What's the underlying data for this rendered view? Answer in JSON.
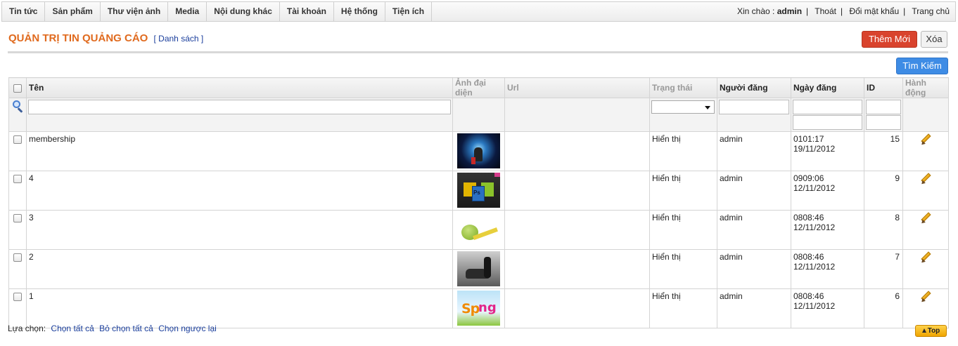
{
  "nav": {
    "menu": [
      "Tin tức",
      "Sản phẩm",
      "Thư viện ảnh",
      "Media",
      "Nội dung khác",
      "Tài khoản",
      "Hệ thống",
      "Tiện ích"
    ],
    "greeting": "Xin chào :",
    "username": "admin",
    "logout": "Thoát",
    "change_password": "Đổi mật khẩu",
    "home": "Trang chủ"
  },
  "header": {
    "title": "QUẢN TRỊ TIN QUẢNG CÁO",
    "sub_link": "[ Danh sách ]",
    "add_button": "Thêm Mới",
    "delete_button": "Xóa",
    "search_button": "Tìm Kiếm"
  },
  "table": {
    "columns": {
      "name": "Tên",
      "image": "Ảnh đại diện",
      "url": "Url",
      "status": "Trạng thái",
      "poster": "Người đăng",
      "date": "Ngày đăng",
      "id": "ID",
      "action": "Hành động"
    },
    "rows": [
      {
        "name": "membership",
        "status": "Hiển thị",
        "poster": "admin",
        "time": "0101:17",
        "date": "19/11/2012",
        "id": "15",
        "image_icon": "membership-thumbnail"
      },
      {
        "name": "4",
        "status": "Hiển thị",
        "poster": "admin",
        "time": "0909:06",
        "date": "12/11/2012",
        "id": "9",
        "image_icon": "adobe-apps-thumbnail"
      },
      {
        "name": "3",
        "status": "Hiển thị",
        "poster": "admin",
        "time": "0808:46",
        "date": "12/11/2012",
        "id": "8",
        "image_icon": "apple-tape-thumbnail"
      },
      {
        "name": "2",
        "status": "Hiển thị",
        "poster": "admin",
        "time": "0808:46",
        "date": "12/11/2012",
        "id": "7",
        "image_icon": "car-man-thumbnail"
      },
      {
        "name": "1",
        "status": "Hiển thị",
        "poster": "admin",
        "time": "0808:46",
        "date": "12/11/2012",
        "id": "6",
        "image_icon": "spring-thumbnail"
      }
    ]
  },
  "footer": {
    "label": "Lựa chọn:",
    "select_all": "Chọn tất cả",
    "deselect_all": "Bỏ chọn tất cả",
    "invert": "Chọn ngược lại",
    "top": "Top"
  },
  "colors": {
    "title_orange": "#e06a1e",
    "link_blue": "#1a3e9c",
    "add_red": "#d9432d",
    "search_blue": "#3e8ce5"
  }
}
